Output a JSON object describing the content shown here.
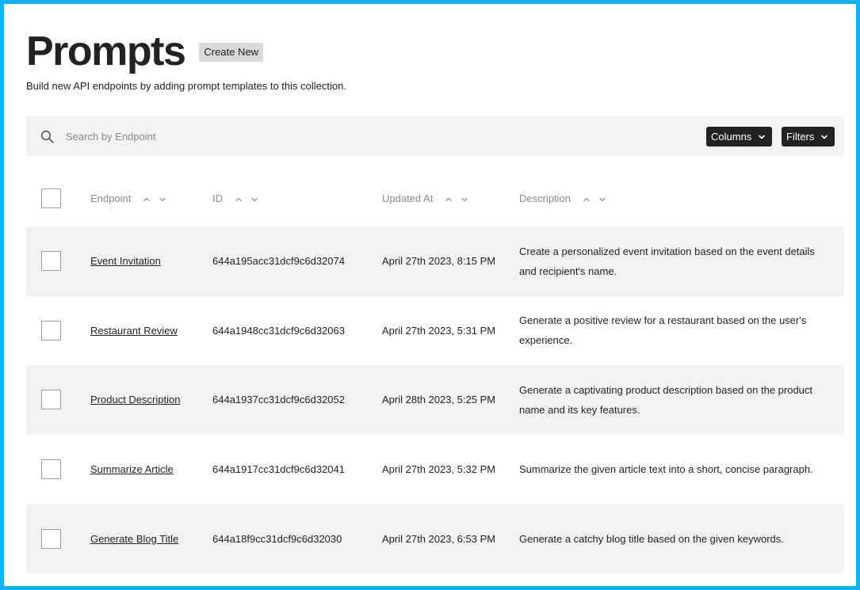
{
  "header": {
    "title": "Prompts",
    "create_label": "Create New",
    "subtitle": "Build new API endpoints by adding prompt templates to this collection."
  },
  "search": {
    "placeholder": "Search by Endpoint",
    "columns_label": "Columns",
    "filters_label": "Filters"
  },
  "table": {
    "columns": [
      "Endpoint",
      "ID",
      "Updated At",
      "Description"
    ],
    "rows": [
      {
        "endpoint": "Event Invitation",
        "id": "644a195acc31dcf9c6d32074",
        "updated": "April 27th 2023, 8:15 PM",
        "description": "Create a personalized event invitation based on the event details and recipient's name."
      },
      {
        "endpoint": "Restaurant Review",
        "id": "644a1948cc31dcf9c6d32063",
        "updated": "April 27th 2023, 5:31 PM",
        "description": "Generate a positive review for a restaurant based on the user's experience."
      },
      {
        "endpoint": "Product Description",
        "id": "644a1937cc31dcf9c6d32052",
        "updated": "April 28th 2023, 5:25 PM",
        "description": "Generate a captivating product description based on the product name and its key features."
      },
      {
        "endpoint": "Summarize Article",
        "id": "644a1917cc31dcf9c6d32041",
        "updated": "April 27th 2023, 5:32 PM",
        "description": "Summarize the given article text into a short, concise paragraph."
      },
      {
        "endpoint": "Generate Blog Title",
        "id": "644a18f9cc31dcf9c6d32030",
        "updated": "April 27th 2023, 6:53 PM",
        "description": "Generate a catchy blog title based on the given keywords."
      }
    ]
  },
  "icons": {
    "search": "search-icon",
    "dropdown": "chevron-down-icon",
    "sort_asc": "chevron-up-icon",
    "sort_desc": "chevron-down-icon"
  },
  "colors": {
    "frame": "#0fb0ef",
    "row_shade": "#f2f2f2",
    "button_dark": "#222222",
    "button_light": "#d9d9d9"
  }
}
